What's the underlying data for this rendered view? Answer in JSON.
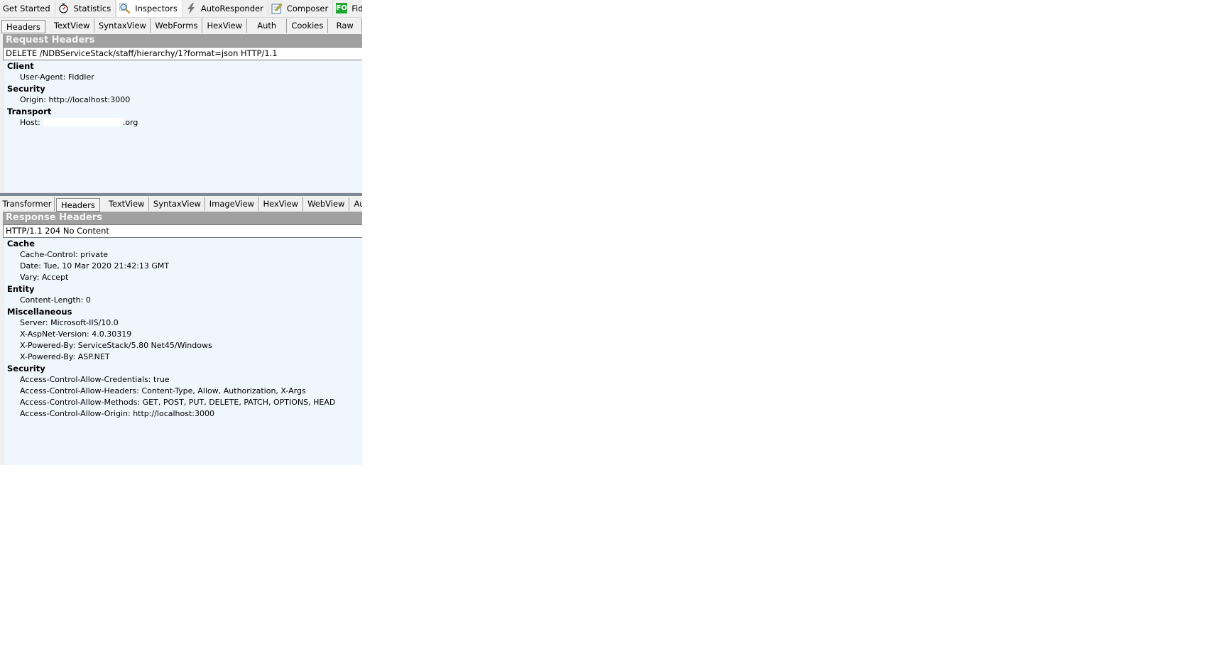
{
  "top_tabs": [
    {
      "label": "Get Started",
      "icon": "none",
      "active": false
    },
    {
      "label": "Statistics",
      "icon": "stopwatch-icon",
      "active": false
    },
    {
      "label": "Inspectors",
      "icon": "magnifier-icon",
      "active": true
    },
    {
      "label": "AutoResponder",
      "icon": "lightning-icon",
      "active": false
    },
    {
      "label": "Composer",
      "icon": "pencil-note-icon",
      "active": false
    },
    {
      "label": "Fiddler Orche",
      "icon": "fo-badge-icon",
      "badge": "FO",
      "active": false
    }
  ],
  "request": {
    "tabs": [
      "Headers",
      "TextView",
      "SyntaxView",
      "WebForms",
      "HexView",
      "Auth",
      "Cookies",
      "Raw"
    ],
    "active_tab": "Headers",
    "section_title": "Request Headers",
    "request_line": "DELETE /NDBServiceStack/staff/hierarchy/1?format=json HTTP/1.1",
    "groups": [
      {
        "name": "Client",
        "items": [
          "User-Agent: Fiddler"
        ]
      },
      {
        "name": "Security",
        "items": [
          "Origin: http://localhost:3000"
        ]
      },
      {
        "name": "Transport",
        "items": []
      }
    ],
    "host_label": "Host:",
    "host_suffix": ".org"
  },
  "response": {
    "tabs": [
      "Transformer",
      "Headers",
      "TextView",
      "SyntaxView",
      "ImageView",
      "HexView",
      "WebView",
      "Au"
    ],
    "active_tab": "Headers",
    "section_title": "Response Headers",
    "status_line": "HTTP/1.1 204 No Content",
    "groups": [
      {
        "name": "Cache",
        "items": [
          "Cache-Control: private",
          "Date: Tue, 10 Mar 2020 21:42:13 GMT",
          "Vary: Accept"
        ]
      },
      {
        "name": "Entity",
        "items": [
          "Content-Length: 0"
        ]
      },
      {
        "name": "Miscellaneous",
        "items": [
          "Server: Microsoft-IIS/10.0",
          "X-AspNet-Version: 4.0.30319",
          "X-Powered-By: ServiceStack/5.80 Net45/Windows",
          "X-Powered-By: ASP.NET"
        ]
      },
      {
        "name": "Security",
        "items": [
          "Access-Control-Allow-Credentials: true",
          "Access-Control-Allow-Headers: Content-Type, Allow, Authorization, X-Args",
          "Access-Control-Allow-Methods: GET, POST, PUT, DELETE, PATCH, OPTIONS, HEAD",
          "Access-Control-Allow-Origin: http://localhost:3000"
        ]
      }
    ]
  },
  "colors": {
    "section_bar": "#a0a0a0",
    "content_bg": "#eff6fd",
    "fo_badge": "#1fa637",
    "splitter": "#7d8a96"
  }
}
